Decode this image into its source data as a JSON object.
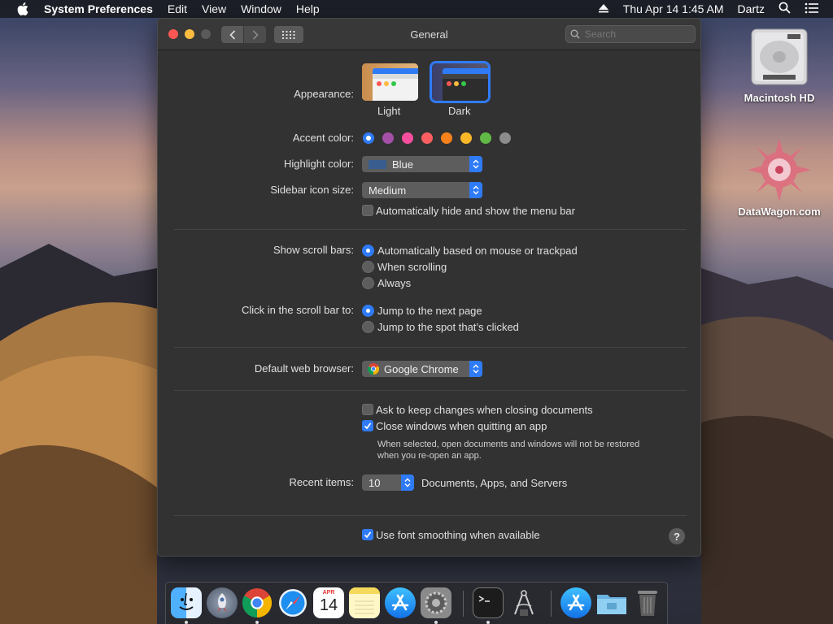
{
  "menubar": {
    "app_name": "System Preferences",
    "menus": [
      "Edit",
      "View",
      "Window",
      "Help"
    ],
    "clock": "Thu Apr 14  1:45 AM",
    "user": "Dartz"
  },
  "window": {
    "title": "General",
    "search_placeholder": "Search"
  },
  "appearance": {
    "label": "Appearance:",
    "options": [
      {
        "name": "Light"
      },
      {
        "name": "Dark",
        "selected": true
      }
    ]
  },
  "accent": {
    "label": "Accent color:",
    "colors": [
      "#2f7bf6",
      "#a550a7",
      "#f74f9e",
      "#fc5f61",
      "#f7821b",
      "#fcb827",
      "#62ba46",
      "#8c8c8c"
    ],
    "selected_index": 0
  },
  "highlight": {
    "label": "Highlight color:",
    "value": "Blue",
    "swatch": "#3a5d8f"
  },
  "sidebar_icon": {
    "label": "Sidebar icon size:",
    "value": "Medium"
  },
  "menu_bar_autohide": {
    "label": "Automatically hide and show the menu bar",
    "checked": false
  },
  "scroll_bars": {
    "label": "Show scroll bars:",
    "options": [
      "Automatically based on mouse or trackpad",
      "When scrolling",
      "Always"
    ],
    "selected_index": 0
  },
  "click_scroll": {
    "label": "Click in the scroll bar to:",
    "options": [
      "Jump to the next page",
      "Jump to the spot that’s clicked"
    ],
    "selected_index": 0
  },
  "browser": {
    "label": "Default web browser:",
    "value": "Google Chrome"
  },
  "ask_keep_changes": {
    "label": "Ask to keep changes when closing documents",
    "checked": false
  },
  "close_windows": {
    "label": "Close windows when quitting an app",
    "checked": true,
    "note_line1": "When selected, open documents and windows will not be restored",
    "note_line2": "when you re-open an app."
  },
  "recent": {
    "label": "Recent items:",
    "value": "10",
    "suffix": "Documents, Apps, and Servers"
  },
  "font_smoothing": {
    "label": "Use font smoothing when available",
    "checked": true
  },
  "help_label": "?",
  "desktop": {
    "icons": [
      {
        "label": "Macintosh HD"
      },
      {
        "label": "DataWagon.com"
      }
    ]
  },
  "dock": {
    "apps": [
      "finder-icon",
      "launchpad-icon",
      "chrome-icon",
      "safari-icon",
      "calendar-icon",
      "notes-icon",
      "app-store-icon",
      "system-preferences-icon",
      "terminal-icon",
      "script-editor-icon",
      "downloads-icon",
      "folder-icon",
      "trash-icon"
    ],
    "calendar_month": "APR",
    "calendar_day": "14"
  }
}
